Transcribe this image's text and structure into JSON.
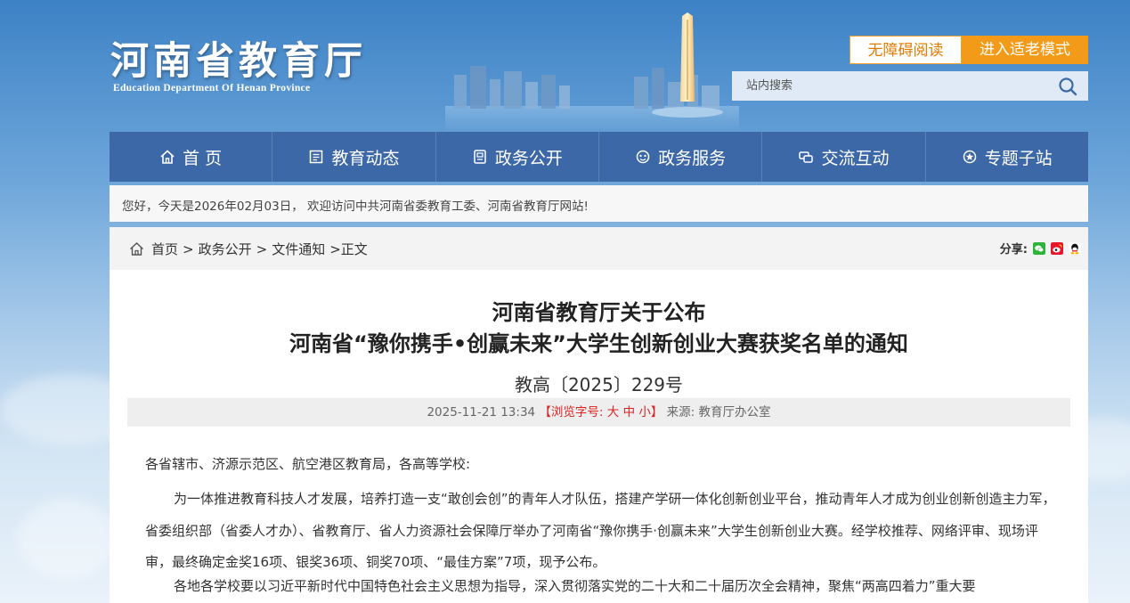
{
  "header": {
    "logo_cn": "河南省教育厅",
    "logo_en": "Education Department Of Henan Province",
    "accessibility_label": "无障碍阅读",
    "elder_mode_label": "进入适老模式",
    "search_placeholder": "站内搜索"
  },
  "nav": [
    {
      "label": "首 页",
      "icon": "home-icon"
    },
    {
      "label": "教育动态",
      "icon": "news-icon"
    },
    {
      "label": "政务公开",
      "icon": "document-icon"
    },
    {
      "label": "政务服务",
      "icon": "service-icon"
    },
    {
      "label": "交流互动",
      "icon": "chat-icon"
    },
    {
      "label": "专题子站",
      "icon": "star-icon"
    }
  ],
  "welcome": "您好，今天是2026年02月03日， 欢迎访问中共河南省委教育工委、河南省教育厅网站!",
  "breadcrumb": {
    "items": [
      "首页",
      "政务公开",
      "文件通知"
    ],
    "separator": ">",
    "current": ">正文"
  },
  "share": {
    "label": "分享:",
    "targets": [
      "wechat-icon",
      "weibo-icon",
      "qq-icon"
    ]
  },
  "article": {
    "title_line1": "河南省教育厅关于公布",
    "title_line2": "河南省“豫你携手•创赢未来”大学生创新创业大赛获奖名单的通知",
    "doc_number": "教高〔2025〕229号",
    "datetime": "2025-11-21 13:34",
    "font_size_prefix": "【浏览字号:",
    "font_large": "大",
    "font_medium": "中",
    "font_small": "小",
    "font_size_suffix": "】",
    "source": "来源: 教育厅办公室",
    "salutation": "各省辖市、济源示范区、航空港区教育局，各高等学校:",
    "paragraph1": "为一体推进教育科技人才发展，培养打造一支“敢创会创”的青年人才队伍，搭建产学研一体化创新创业平台，推动青年人才成为创业创新创造主力军，省委组织部（省委人才办）、省教育厅、省人力资源社会保障厅举办了河南省“豫你携手·创赢未来”大学生创新创业大赛。经学校推荐、网络评审、现场评审，最终确定金奖16项、银奖36项、铜奖70项、“最佳方案”7项，现予公布。",
    "paragraph2": "各地各学校要以习近平新时代中国特色社会主义思想为指导，深入贯彻落实党的二十大和二十届历次全会精神，聚焦“两高四着力”重大要"
  },
  "colors": {
    "nav_bg": "#3d68a7",
    "accent_orange": "#f39b18",
    "font_size_red": "#dd2222"
  }
}
